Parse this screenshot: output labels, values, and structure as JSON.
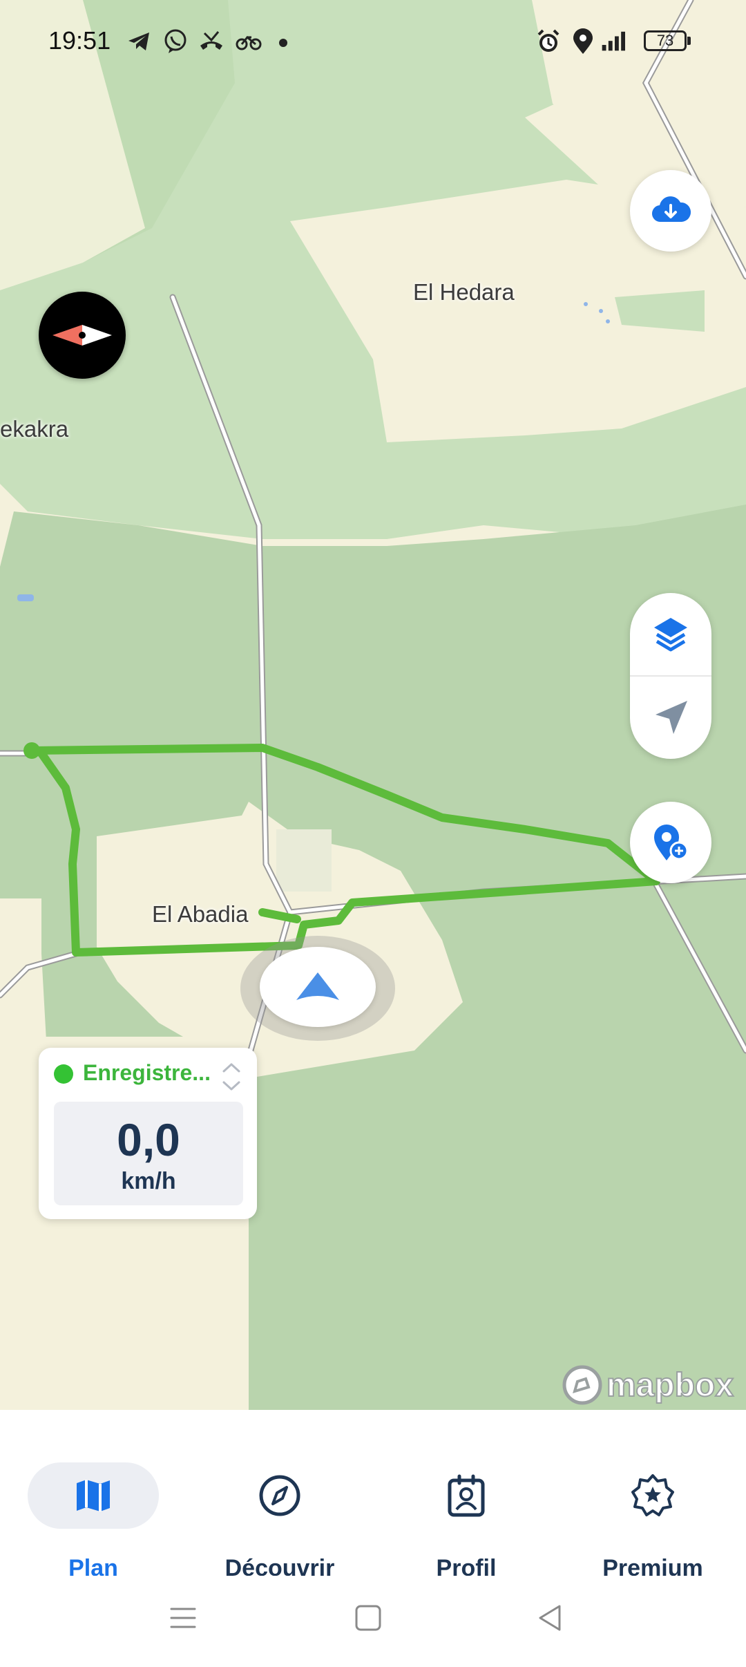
{
  "status_bar": {
    "time": "19:51",
    "left_icons": [
      "telegram-icon",
      "viber-icon",
      "missed-call-icon",
      "bike-icon",
      "dot-icon"
    ],
    "right_icons": [
      "alarm-icon",
      "location-icon",
      "signal-icon",
      "battery-icon"
    ],
    "battery": "73"
  },
  "map": {
    "labels": {
      "el_hedara": "El Hedara",
      "ekakra": "ekakra",
      "el_abadia": "El Abadia"
    },
    "attribution": "mapbox",
    "colors": {
      "track": "#5dbb3b",
      "accent": "#1a73e8"
    }
  },
  "controls": {
    "download": "cloud-download-icon",
    "compass": "compass-icon",
    "layers": "layers-icon",
    "locate": "locate-arrow-icon",
    "add_poi": "add-poi-icon",
    "position": "navigation-arrow-icon"
  },
  "recording": {
    "status": "Enregistre...",
    "speed": "0,0",
    "unit": "km/h"
  },
  "nav": {
    "items": [
      {
        "label": "Plan",
        "icon": "map-icon",
        "active": true
      },
      {
        "label": "Découvrir",
        "icon": "compass-icon"
      },
      {
        "label": "Profil",
        "icon": "profile-icon"
      },
      {
        "label": "Premium",
        "icon": "premium-badge-icon"
      }
    ]
  },
  "system_nav": [
    "menu-icon",
    "home-icon",
    "back-icon"
  ]
}
